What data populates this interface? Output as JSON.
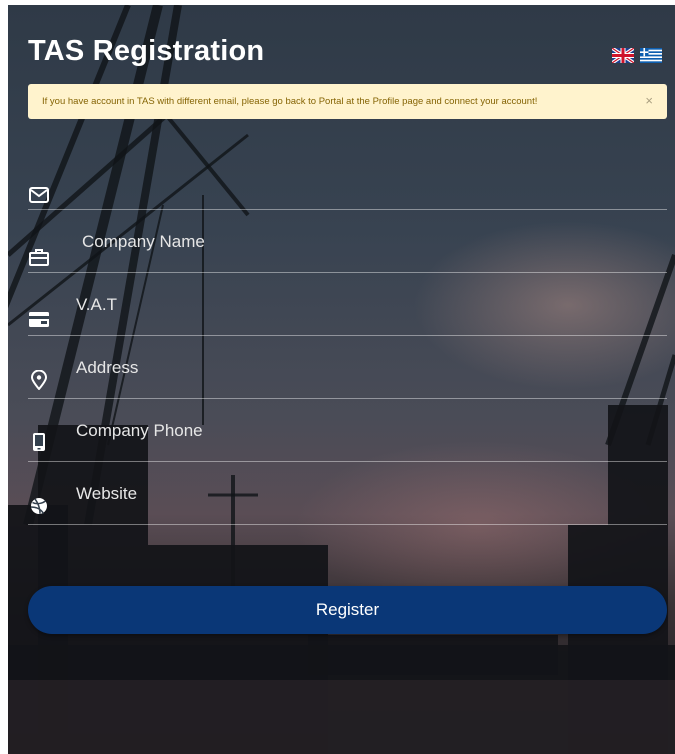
{
  "header": {
    "title": "TAS Registration"
  },
  "languages": [
    {
      "name": "English",
      "icon": "uk-flag-icon"
    },
    {
      "name": "Greek",
      "icon": "greece-flag-icon"
    }
  ],
  "alert": {
    "message": "If you have account in TAS with different email, please go back to Portal at the Profile page and connect your account!",
    "close_label": "×"
  },
  "form": {
    "fields": [
      {
        "name": "email",
        "icon": "envelope-icon",
        "placeholder": "",
        "value": ""
      },
      {
        "name": "company_name",
        "icon": "briefcase-icon",
        "placeholder": "Company Name",
        "value": ""
      },
      {
        "name": "vat",
        "icon": "credit-card-icon",
        "placeholder": "V.A.T",
        "value": ""
      },
      {
        "name": "address",
        "icon": "map-pin-icon",
        "placeholder": "Address",
        "value": ""
      },
      {
        "name": "company_phone",
        "icon": "mobile-phone-icon",
        "placeholder": "Company Phone",
        "value": ""
      },
      {
        "name": "website",
        "icon": "dribbble-icon",
        "placeholder": "Website",
        "value": ""
      }
    ],
    "submit_label": "Register"
  },
  "colors": {
    "primary_button": "#0a3777",
    "alert_background": "#fff3cd",
    "alert_text": "#856404"
  }
}
